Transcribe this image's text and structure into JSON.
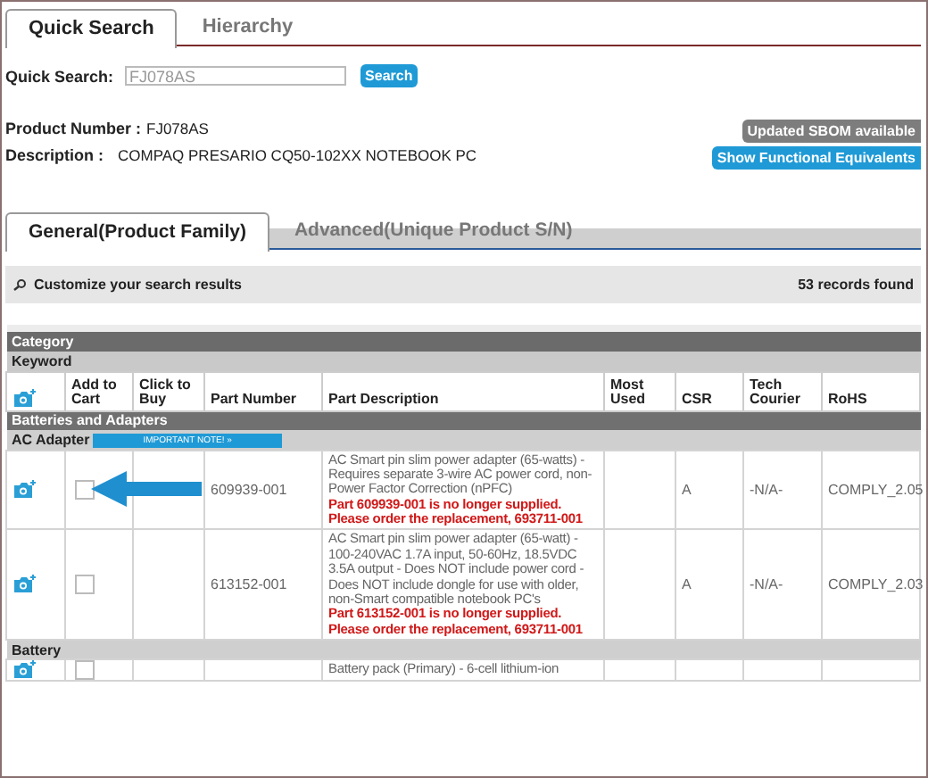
{
  "tabs": [
    {
      "label": "Quick Search",
      "selected": true
    },
    {
      "label": "Hierarchy",
      "selected": false
    }
  ],
  "quick_search": {
    "label": "Quick Search:",
    "value": "FJ078AS",
    "button": "Search"
  },
  "product": {
    "number_label": "Product Number :",
    "number": "FJ078AS",
    "description_label": "Description :",
    "description": "COMPAQ PRESARIO CQ50-102XX NOTEBOOK PC"
  },
  "actions": [
    {
      "label": "Updated SBOM available",
      "kind": "grey"
    },
    {
      "label": "Show Functional Equivalents",
      "kind": "blue"
    }
  ],
  "subtabs": [
    {
      "label": "General(Product Family)",
      "selected": true
    },
    {
      "label": "Advanced(Unique Product S/N)",
      "selected": false
    }
  ],
  "customize": {
    "label": "Customize your search results",
    "count": "53 records found"
  },
  "table": {
    "category": "Category",
    "keyword": "Keyword",
    "columns": [
      "Add to Cart",
      "Click to Buy",
      "Part Number",
      "Part Description",
      "Most Used",
      "CSR",
      "Tech Courier",
      "RoHS"
    ],
    "groups": [
      {
        "name": "Batteries and Adapters",
        "subgroups": [
          {
            "name": "AC Adapter",
            "note": "IMPORTANT NOTE! »",
            "rows": [
              {
                "checked": false,
                "part_number": "609939-001",
                "description": "AC Smart pin slim power adapter (65-watts) - Requires separate 3-wire AC power cord, non-Power Factor Correction (nPFC)",
                "notice": "Part 609939-001 is no longer supplied. Please order the replacement, 693711-001",
                "csr": "A",
                "tech_courier": "-N/A-",
                "rohs": "COMPLY_2.05"
              },
              {
                "checked": false,
                "part_number": "613152-001",
                "description": "AC Smart pin slim power adapter (65-watt) - 100-240VAC 1.7A input, 50-60Hz, 18.5VDC 3.5A output - Does NOT include power cord - Does NOT include dongle for use with older, non-Smart compatible notebook PC's",
                "notice": "Part 613152-001 is no longer supplied. Please order the replacement, 693711-001",
                "csr": "A",
                "tech_courier": "-N/A-",
                "rohs": "COMPLY_2.03"
              }
            ]
          },
          {
            "name": "Battery",
            "rows": [
              {
                "checked": false,
                "description": "Battery pack (Primary) - 6-cell lithium-ion"
              }
            ]
          }
        ]
      }
    ]
  }
}
